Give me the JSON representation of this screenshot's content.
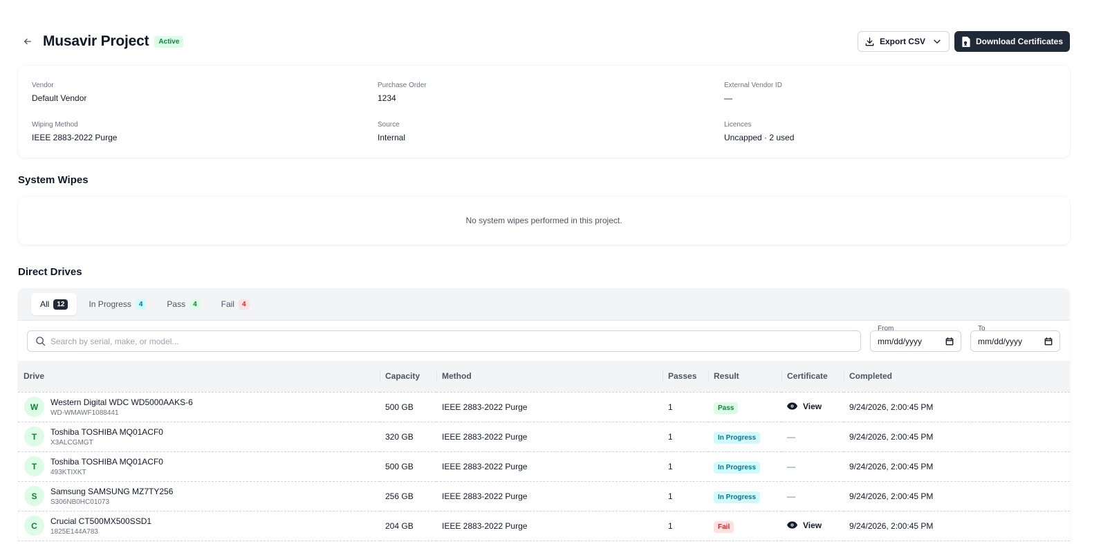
{
  "header": {
    "title": "Musavir Project",
    "status": "Active",
    "export_label": "Export CSV",
    "download_label": "Download Certificates"
  },
  "info": {
    "vendor_label": "Vendor",
    "vendor_value": "Default Vendor",
    "po_label": "Purchase Order",
    "po_value": "1234",
    "ext_label": "External Vendor ID",
    "ext_value": "—",
    "method_label": "Wiping Method",
    "method_value": "IEEE 2883-2022 Purge",
    "source_label": "Source",
    "source_value": "Internal",
    "licences_label": "Licences",
    "licences_value": "Uncapped · 2 used"
  },
  "system_wipes": {
    "title": "System Wipes",
    "empty_text": "No system wipes performed in this project."
  },
  "direct_drives": {
    "title": "Direct Drives",
    "tabs": [
      {
        "label": "All",
        "count": "12"
      },
      {
        "label": "In Progress",
        "count": "4"
      },
      {
        "label": "Pass",
        "count": "4"
      },
      {
        "label": "Fail",
        "count": "4"
      }
    ],
    "search_placeholder": "Search by serial, make, or model...",
    "from_label": "From",
    "to_label": "To",
    "date_placeholder": "mm/dd/yyyy",
    "columns": [
      "Drive",
      "Capacity",
      "Method",
      "Passes",
      "Result",
      "Certificate",
      "Completed"
    ],
    "rows": [
      {
        "initial": "W",
        "name": "Western Digital WDC WD5000AAKS-6",
        "serial": "WD-WMAWF1088441",
        "capacity": "500 GB",
        "method": "IEEE 2883-2022 Purge",
        "passes": "1",
        "result": "Pass",
        "certificate": "View",
        "completed": "9/24/2026, 2:00:45 PM"
      },
      {
        "initial": "T",
        "name": "Toshiba TOSHIBA MQ01ACF0",
        "serial": "X3ALCGMGT",
        "capacity": "320 GB",
        "method": "IEEE 2883-2022 Purge",
        "passes": "1",
        "result": "In Progress",
        "certificate": "—",
        "completed": "9/24/2026, 2:00:45 PM"
      },
      {
        "initial": "T",
        "name": "Toshiba TOSHIBA MQ01ACF0",
        "serial": "493KTIXKT",
        "capacity": "500 GB",
        "method": "IEEE 2883-2022 Purge",
        "passes": "1",
        "result": "In Progress",
        "certificate": "—",
        "completed": "9/24/2026, 2:00:45 PM"
      },
      {
        "initial": "S",
        "name": "Samsung SAMSUNG MZ7TY256",
        "serial": "S306NB0HC01073",
        "capacity": "256 GB",
        "method": "IEEE 2883-2022 Purge",
        "passes": "1",
        "result": "In Progress",
        "certificate": "—",
        "completed": "9/24/2026, 2:00:45 PM"
      },
      {
        "initial": "C",
        "name": "Crucial CT500MX500SSD1",
        "serial": "1825E144A783",
        "capacity": "204 GB",
        "method": "IEEE 2883-2022 Purge",
        "passes": "1",
        "result": "Fail",
        "certificate": "View",
        "completed": "9/24/2026, 2:00:45 PM"
      }
    ]
  },
  "icons": {
    "back": "arrow-left-icon",
    "export": "download-icon",
    "export_menu": "chevron-down-icon",
    "certificates": "file-certificate-icon",
    "search": "search-icon",
    "calendar": "calendar-icon",
    "view": "eye-icon"
  }
}
